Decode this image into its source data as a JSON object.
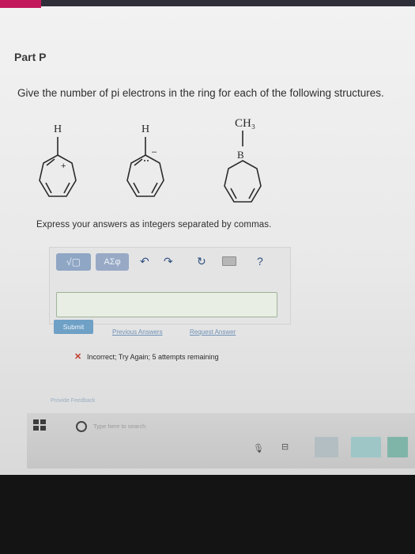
{
  "header": {
    "part_title": "Part P"
  },
  "question": {
    "text": "Give the number of pi electrons in the ring for each of the following structures.",
    "structures": [
      {
        "top_label": "H",
        "mark": "+"
      },
      {
        "top_label": "H",
        "mark": "–"
      },
      {
        "top_label": "CH₃",
        "atom": "B"
      }
    ]
  },
  "instruction": "Express your answers as integers separated by commas.",
  "toolbar": {
    "template_button": "√▢",
    "symbols_button": "ΑΣφ",
    "help": "?"
  },
  "answer": {
    "value": ""
  },
  "actions": {
    "submit": "Submit",
    "previous_answers": "Previous Answers",
    "request_answer": "Request Answer"
  },
  "feedback": {
    "icon": "✕",
    "text": "Incorrect; Try Again; 5 attempts remaining"
  },
  "provide_feedback": "Provide Feedback",
  "taskbar": {
    "search_placeholder": "Type here to search"
  },
  "colors": {
    "accent": "#c2185b",
    "toolbar_button": "#8fa6c4",
    "submit_button": "#6fa0c5",
    "link": "#6f92b7",
    "error": "#c0392b"
  }
}
